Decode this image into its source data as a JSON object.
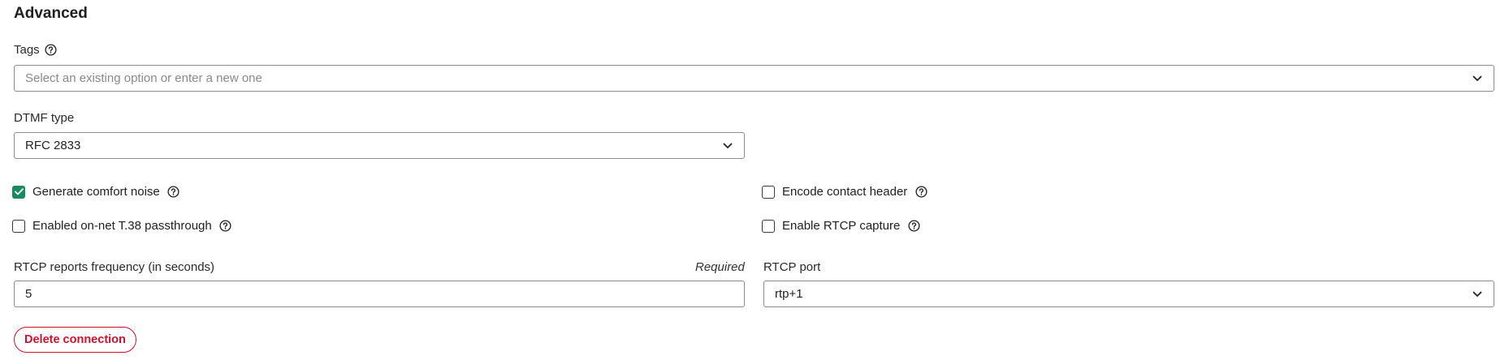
{
  "section": {
    "title": "Advanced"
  },
  "tags": {
    "label": "Tags",
    "placeholder": "Select an existing option or enter a new one"
  },
  "dtmf": {
    "label": "DTMF type",
    "value": "RFC 2833"
  },
  "checkboxes": {
    "comfort_noise": {
      "label": "Generate comfort noise",
      "checked": true
    },
    "encode_contact": {
      "label": "Encode contact header",
      "checked": false
    },
    "t38": {
      "label": "Enabled on-net T.38 passthrough",
      "checked": false
    },
    "rtcp_capture": {
      "label": "Enable RTCP capture",
      "checked": false
    }
  },
  "rtcp_frequency": {
    "label": "RTCP reports frequency (in seconds)",
    "required_text": "Required",
    "value": "5"
  },
  "rtcp_port": {
    "label": "RTCP port",
    "value": "rtp+1"
  },
  "actions": {
    "delete_label": "Delete connection"
  },
  "colors": {
    "accent_green": "#1a8a5f",
    "danger_red": "#d0112b",
    "border": "#8c8c8c"
  }
}
